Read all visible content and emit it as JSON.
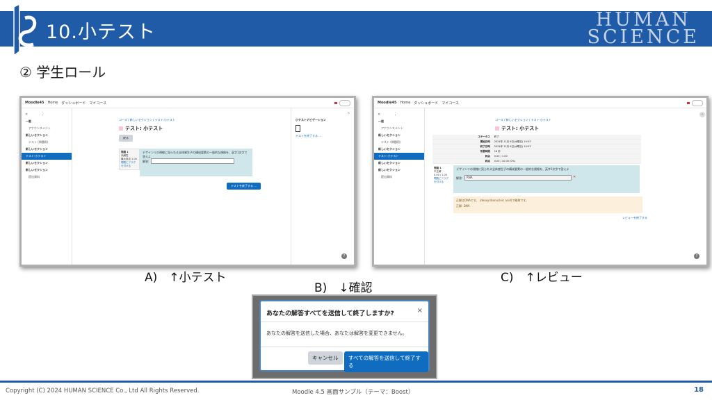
{
  "header": {
    "title": "10.小テスト",
    "brand_line1": "HUMAN",
    "brand_line2": "SCIENCE"
  },
  "subtitle": "② 学生ロール",
  "moodle": {
    "site_name": "Moodle45",
    "nav": [
      "Home",
      "ダッシュボード",
      "マイコース"
    ],
    "sidebar": [
      {
        "label": "一般",
        "type": "section"
      },
      {
        "label": "アナウンスメント",
        "type": "sub"
      },
      {
        "label": "新しいセクション",
        "type": "section"
      },
      {
        "label": "テスト (問題用)",
        "type": "sub"
      },
      {
        "label": "新しいセクション",
        "type": "section"
      },
      {
        "label": "テスト:小テスト",
        "type": "active"
      },
      {
        "label": "新しいセクション",
        "type": "section"
      },
      {
        "label": "新しいセクション",
        "type": "section"
      },
      {
        "label": "提出資料",
        "type": "sub"
      }
    ],
    "breadcrumb": "コース / 新しいセクション / テスト:小テスト",
    "page_title": "テスト: 小テスト",
    "back_button": "戻る",
    "question_label": "問題 1",
    "question_status": "未解答",
    "question_points": "最大評点 1.00",
    "question_flag": "問題にフラグを付ける",
    "question_text": "デザインリの視線に見られる全体感生子の構成要素の一般的な規格を、英字1文字で答えよ",
    "answer_label": "解答:",
    "finish_button": "テストを終了する ...",
    "nav_panel_title": "小テストナビゲーション",
    "nav_panel_link": "テストを終了する ...",
    "help": "?"
  },
  "review": {
    "rows": [
      {
        "k": "ステータス",
        "v": "終了"
      },
      {
        "k": "開始日時",
        "v": "2024年 11月 6日(水曜日) 10:03"
      },
      {
        "k": "終了日時",
        "v": "2024年 11月 6日(水曜日) 10:03"
      },
      {
        "k": "所要時間",
        "v": "16 秒"
      },
      {
        "k": "評点",
        "v": "0.00 / 1.00"
      },
      {
        "k": "評点",
        "v": "0.00 / 10.00 (0%)"
      }
    ],
    "question_status": "不正解",
    "question_points": "0.00 / 1.00",
    "answer_value": "RNA",
    "feedback_line1": "正解はDNAです。 (deoxyribonucleic acid)で略称です。",
    "feedback_line2": "正解: DNA",
    "finish_review": "レビューを終了する"
  },
  "captions": {
    "a": "A)　↑小テスト",
    "b": "B)　↓確認",
    "c": "C)　↑レビュー"
  },
  "dialog": {
    "title": "あなたの解答すべてを送信して終了しますか?",
    "close": "×",
    "body": "あなたの解答を送信した場合、あなたは解答を変更できません。",
    "cancel": "キャンセル",
    "submit": "すべての解答を送信して終了する"
  },
  "footer": {
    "copyright": "Copyright (C) 2024 HUMAN SCIENCE Co., Ltd All Rights Reserved.",
    "center": "Moodle 4.5 画面サンプル（テーマ：Boost）",
    "page": "18"
  }
}
